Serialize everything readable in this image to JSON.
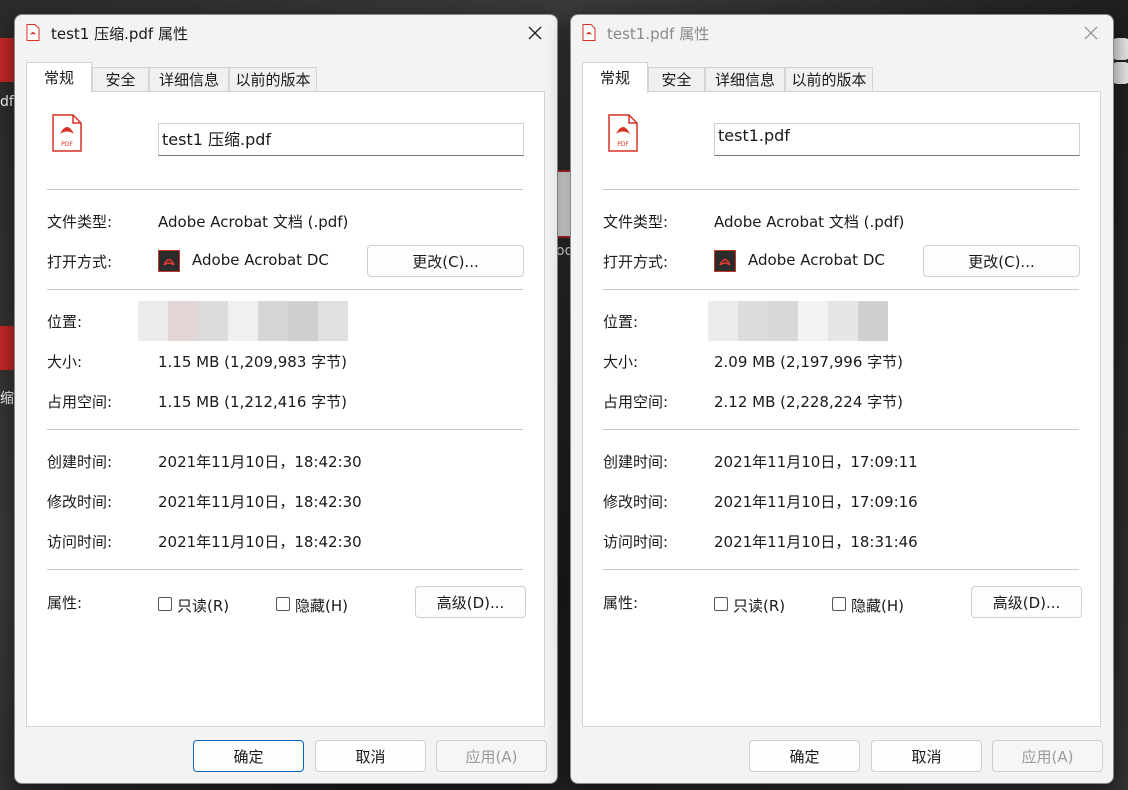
{
  "desktop": {
    "fragments": [
      "df",
      "缩.",
      "od"
    ]
  },
  "dialogs": [
    {
      "title": "test1 压缩.pdf 属性",
      "active": true,
      "tabs": [
        "常规",
        "安全",
        "详细信息",
        "以前的版本"
      ],
      "filename": "test1 压缩.pdf",
      "icon_caption": "PDF",
      "rows": {
        "file_type_label": "文件类型:",
        "file_type": "Adobe Acrobat 文档 (.pdf)",
        "open_with_label": "打开方式:",
        "open_with": "Adobe Acrobat DC",
        "change_button": "更改(C)...",
        "location_label": "位置:",
        "size_label": "大小:",
        "size": "1.15 MB (1,209,983 字节)",
        "disk_label": "占用空间:",
        "disk": "1.15 MB (1,212,416 字节)",
        "created_label": "创建时间:",
        "created": "2021年11月10日，18:42:30",
        "modified_label": "修改时间:",
        "modified": "2021年11月10日，18:42:30",
        "accessed_label": "访问时间:",
        "accessed": "2021年11月10日，18:42:30",
        "attributes_label": "属性:",
        "readonly": "只读(R)",
        "hidden": "隐藏(H)",
        "advanced_button": "高级(D)..."
      },
      "buttons": {
        "ok": "确定",
        "cancel": "取消",
        "apply": "应用(A)"
      }
    },
    {
      "title": "test1.pdf 属性",
      "active": false,
      "tabs": [
        "常规",
        "安全",
        "详细信息",
        "以前的版本"
      ],
      "filename": "test1.pdf",
      "icon_caption": "PDF",
      "rows": {
        "file_type_label": "文件类型:",
        "file_type": "Adobe Acrobat 文档 (.pdf)",
        "open_with_label": "打开方式:",
        "open_with": "Adobe Acrobat DC",
        "change_button": "更改(C)...",
        "location_label": "位置:",
        "size_label": "大小:",
        "size": "2.09 MB (2,197,996 字节)",
        "disk_label": "占用空间:",
        "disk": "2.12 MB (2,228,224 字节)",
        "created_label": "创建时间:",
        "created": "2021年11月10日，17:09:11",
        "modified_label": "修改时间:",
        "modified": "2021年11月10日，17:09:16",
        "accessed_label": "访问时间:",
        "accessed": "2021年11月10日，18:31:46",
        "attributes_label": "属性:",
        "readonly": "只读(R)",
        "hidden": "隐藏(H)",
        "advanced_button": "高级(D)..."
      },
      "buttons": {
        "ok": "确定",
        "cancel": "取消",
        "apply": "应用(A)"
      }
    }
  ],
  "colors": {
    "accent": "#0067c0",
    "pdf_red": "#d93025",
    "acrobat_dark": "#2b2b2b"
  },
  "icons": [
    "pdf-file-icon",
    "acrobat-icon",
    "close-icon",
    "checkbox-icon"
  ]
}
